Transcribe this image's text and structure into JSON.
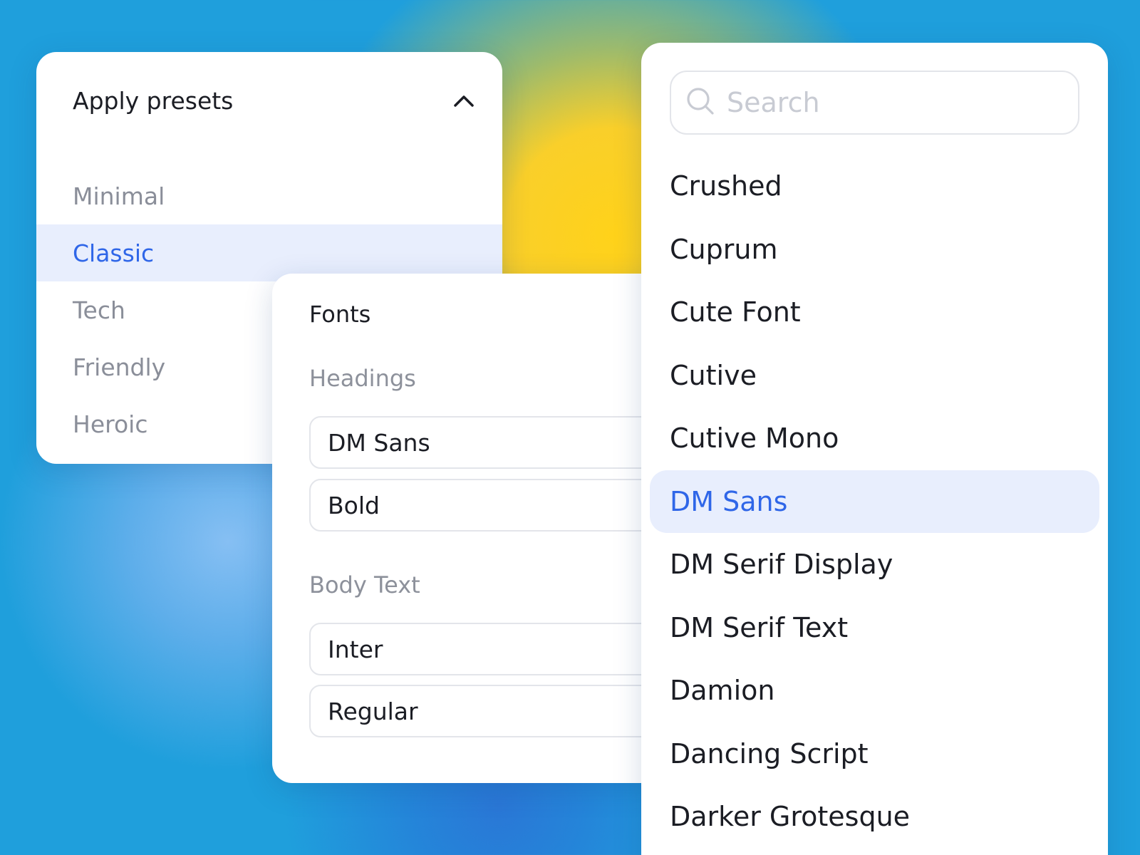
{
  "presets": {
    "title": "Apply presets",
    "items": [
      {
        "label": "Minimal"
      },
      {
        "label": "Classic"
      },
      {
        "label": "Tech"
      },
      {
        "label": "Friendly"
      },
      {
        "label": "Heroic"
      }
    ],
    "selected": "Classic"
  },
  "fonts": {
    "title": "Fonts",
    "headings": {
      "label": "Headings",
      "family": "DM Sans",
      "weight": "Bold"
    },
    "body": {
      "label": "Body Text",
      "family": "Inter",
      "weight": "Regular"
    }
  },
  "font_picker": {
    "search_placeholder": "Search",
    "items": [
      {
        "label": "Crushed"
      },
      {
        "label": "Cuprum"
      },
      {
        "label": "Cute Font"
      },
      {
        "label": "Cutive"
      },
      {
        "label": "Cutive Mono"
      },
      {
        "label": "DM Sans"
      },
      {
        "label": "DM Serif Display"
      },
      {
        "label": "DM Serif Text"
      },
      {
        "label": "Damion"
      },
      {
        "label": "Dancing Script"
      },
      {
        "label": "Darker Grotesque"
      }
    ],
    "selected": "DM Sans"
  },
  "icons": {
    "collapse": "chevron-up-icon",
    "search": "search-icon"
  },
  "colors": {
    "accent": "#2f66e8",
    "selected_bg": "#e8eefd",
    "muted_text": "#8a8e99"
  }
}
